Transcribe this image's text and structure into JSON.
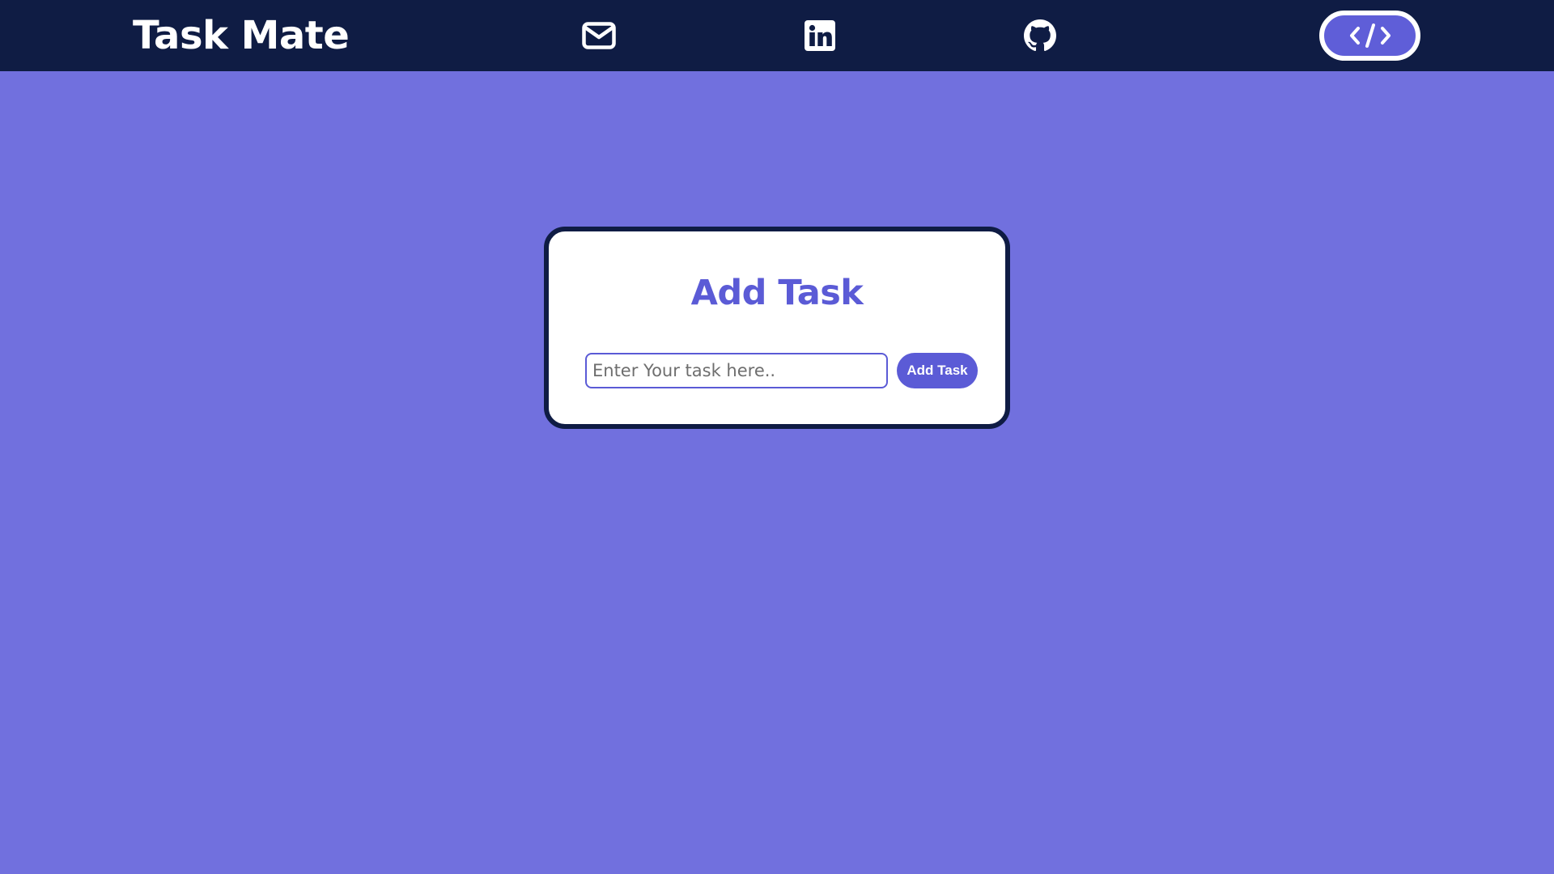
{
  "app": {
    "title": "Task Mate"
  },
  "nav": {
    "icons": [
      {
        "name": "mail-icon"
      },
      {
        "name": "linkedin-icon"
      },
      {
        "name": "github-icon"
      }
    ],
    "code_button_icon": "code-icon"
  },
  "card": {
    "title": "Add Task",
    "input": {
      "value": "",
      "placeholder": "Enter Your task here.."
    },
    "button_label": "Add Task"
  },
  "colors": {
    "background": "#7170de",
    "navbar": "#0f1c44",
    "accent": "#5b5bd6",
    "card": "#ffffff"
  }
}
